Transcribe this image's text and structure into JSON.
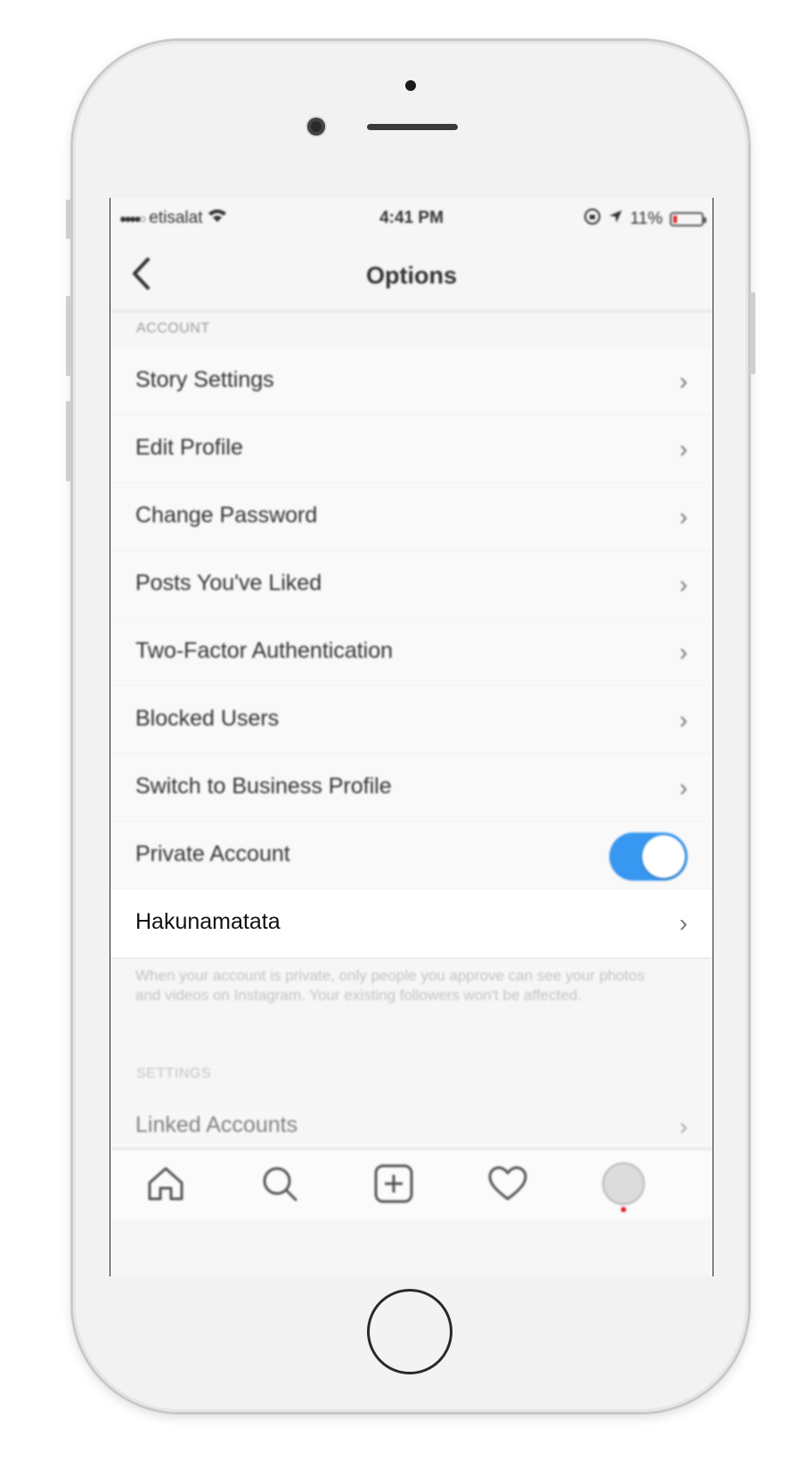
{
  "status_bar": {
    "carrier": "etisalat",
    "time": "4:41 PM",
    "battery": "11%"
  },
  "nav": {
    "title": "Options"
  },
  "account": {
    "header": "ACCOUNT",
    "items": [
      {
        "label": "Story Settings"
      },
      {
        "label": "Edit Profile"
      },
      {
        "label": "Change Password"
      },
      {
        "label": "Posts You've Liked"
      },
      {
        "label": "Two-Factor Authentication"
      },
      {
        "label": "Blocked Users"
      },
      {
        "label": "Switch to Business Profile"
      }
    ],
    "private_account": {
      "label": "Private Account",
      "enabled": true
    },
    "highlight_item": {
      "label": "Hakunamatata"
    },
    "footer_note": "When your account is private, only people you approve can see your photos and videos on Instagram. Your existing followers won't be affected."
  },
  "settings": {
    "header": "SETTINGS",
    "items": [
      {
        "label": "Linked Accounts"
      }
    ]
  },
  "tabbar": {
    "items": [
      "home-icon",
      "search-icon",
      "add-post-icon",
      "activity-heart-icon",
      "profile-avatar"
    ]
  },
  "colors": {
    "toggle_on": "#3897f0",
    "battery_low": "#e02020",
    "notification_dot": "#e02020"
  }
}
